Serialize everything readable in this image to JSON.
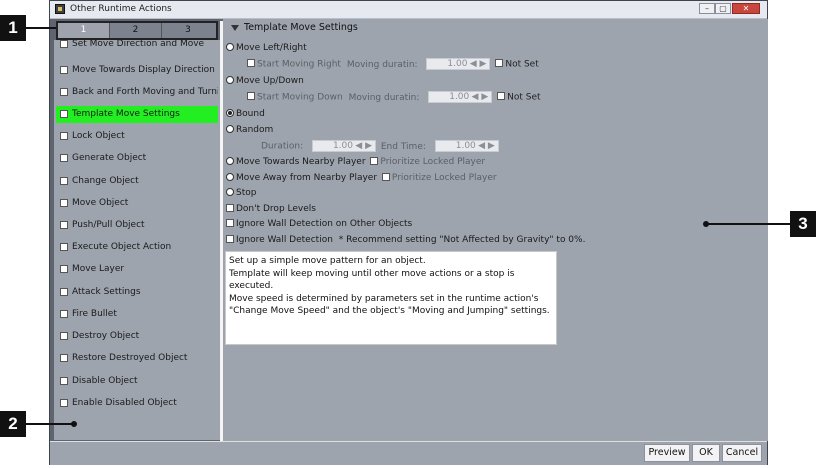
{
  "window": {
    "title": "Other Runtime Actions",
    "minimize_glyph": "–",
    "maximize_glyph": "▢",
    "close_glyph": "✕"
  },
  "tabs": [
    {
      "label": "1",
      "active": true
    },
    {
      "label": "2",
      "active": false
    },
    {
      "label": "3",
      "active": false
    }
  ],
  "left_list": {
    "items": [
      {
        "label": "Set Move Direction and Move"
      },
      {
        "label": "Move Towards Display Direction"
      },
      {
        "label": "Back and Forth Moving and Turning"
      },
      {
        "label": "Template Move Settings",
        "selected": true
      },
      {
        "label": "Lock Object"
      },
      {
        "label": "Generate Object"
      },
      {
        "label": "Change Object"
      },
      {
        "label": "Move Object"
      },
      {
        "label": "Push/Pull Object"
      },
      {
        "label": "Execute Object Action"
      },
      {
        "label": "Move Layer"
      },
      {
        "label": "Attack Settings"
      },
      {
        "label": "Fire Bullet"
      },
      {
        "label": "Destroy Object"
      },
      {
        "label": "Restore Destroyed Object"
      },
      {
        "label": "Disable Object"
      },
      {
        "label": "Enable Disabled Object"
      }
    ]
  },
  "settings": {
    "section_title": "Template Move Settings",
    "move_left_right": "Move Left/Right",
    "start_moving_right": "Start Moving Right",
    "moving_duration_label_1": "Moving duratin:",
    "moving_duration_value_1": "1.00",
    "not_set_1": "Not Set",
    "move_up_down": "Move Up/Down",
    "start_moving_down": "Start Moving Down",
    "moving_duration_label_2": "Moving duratin:",
    "moving_duration_value_2": "1.00",
    "not_set_2": "Not Set",
    "bound": "Bound",
    "random": "Random",
    "duration_label": "Duration:",
    "duration_value": "1.00",
    "end_time_label": "End Time:",
    "end_time_value": "1.00",
    "move_towards_player": "Move Towards Nearby Player",
    "prioritize_locked_1": "Prioritize Locked Player",
    "move_away_player": "Move Away from Nearby Player",
    "prioritize_locked_2": "Prioritize Locked Player",
    "stop": "Stop",
    "dont_drop": "Don't Drop Levels",
    "ignore_wall_other": "Ignore Wall Detection on Other Objects",
    "ignore_wall": "Ignore Wall Detection",
    "recommend_note": "* Recommend setting \"Not Affected by Gravity\" to 0%.",
    "description": [
      "Set up a simple move pattern for an object.",
      "Template will keep moving until other move actions or a stop is",
      "executed.",
      "Move speed is determined by parameters set in the runtime action's",
      "\"Change Move Speed\" and the object's \"Moving and Jumping\" settings."
    ]
  },
  "buttons": {
    "preview": "Preview",
    "ok": "OK",
    "cancel": "Cancel"
  },
  "callouts": {
    "one": "1",
    "two": "2",
    "three": "3"
  },
  "colors": {
    "selected_item": "#22ee22",
    "panel": "#9ea4ae"
  }
}
